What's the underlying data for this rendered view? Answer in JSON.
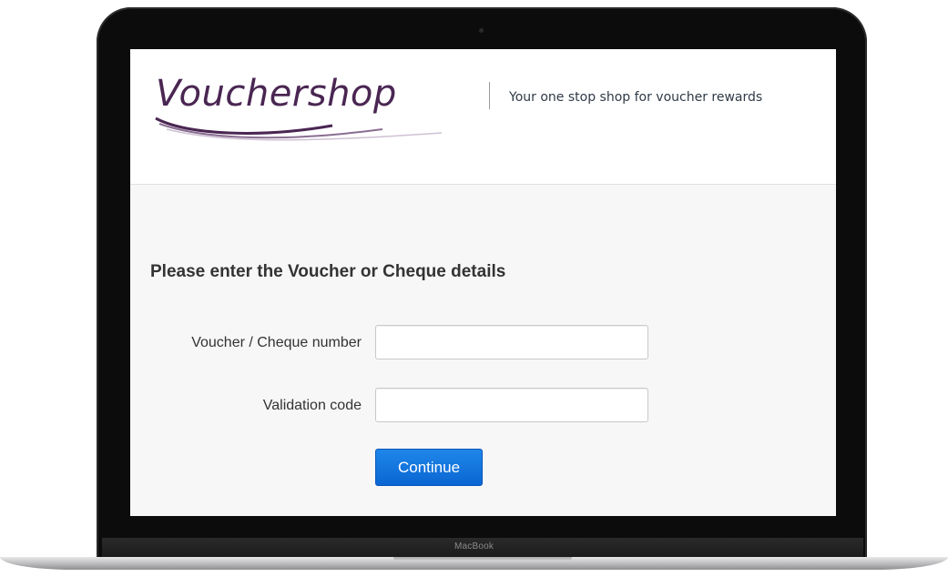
{
  "header": {
    "logo_text": "Vouchershop",
    "tagline": "Your one stop shop for voucher rewards"
  },
  "form": {
    "title": "Please enter the Voucher or Cheque details",
    "fields": [
      {
        "label": "Voucher / Cheque number",
        "value": "",
        "placeholder": ""
      },
      {
        "label": "Validation code",
        "value": "",
        "placeholder": ""
      }
    ],
    "submit_label": "Continue"
  },
  "device": {
    "brand_label": "MacBook"
  },
  "colors": {
    "logo": "#4a2652",
    "button": "#0a66d2",
    "text": "#333333"
  }
}
